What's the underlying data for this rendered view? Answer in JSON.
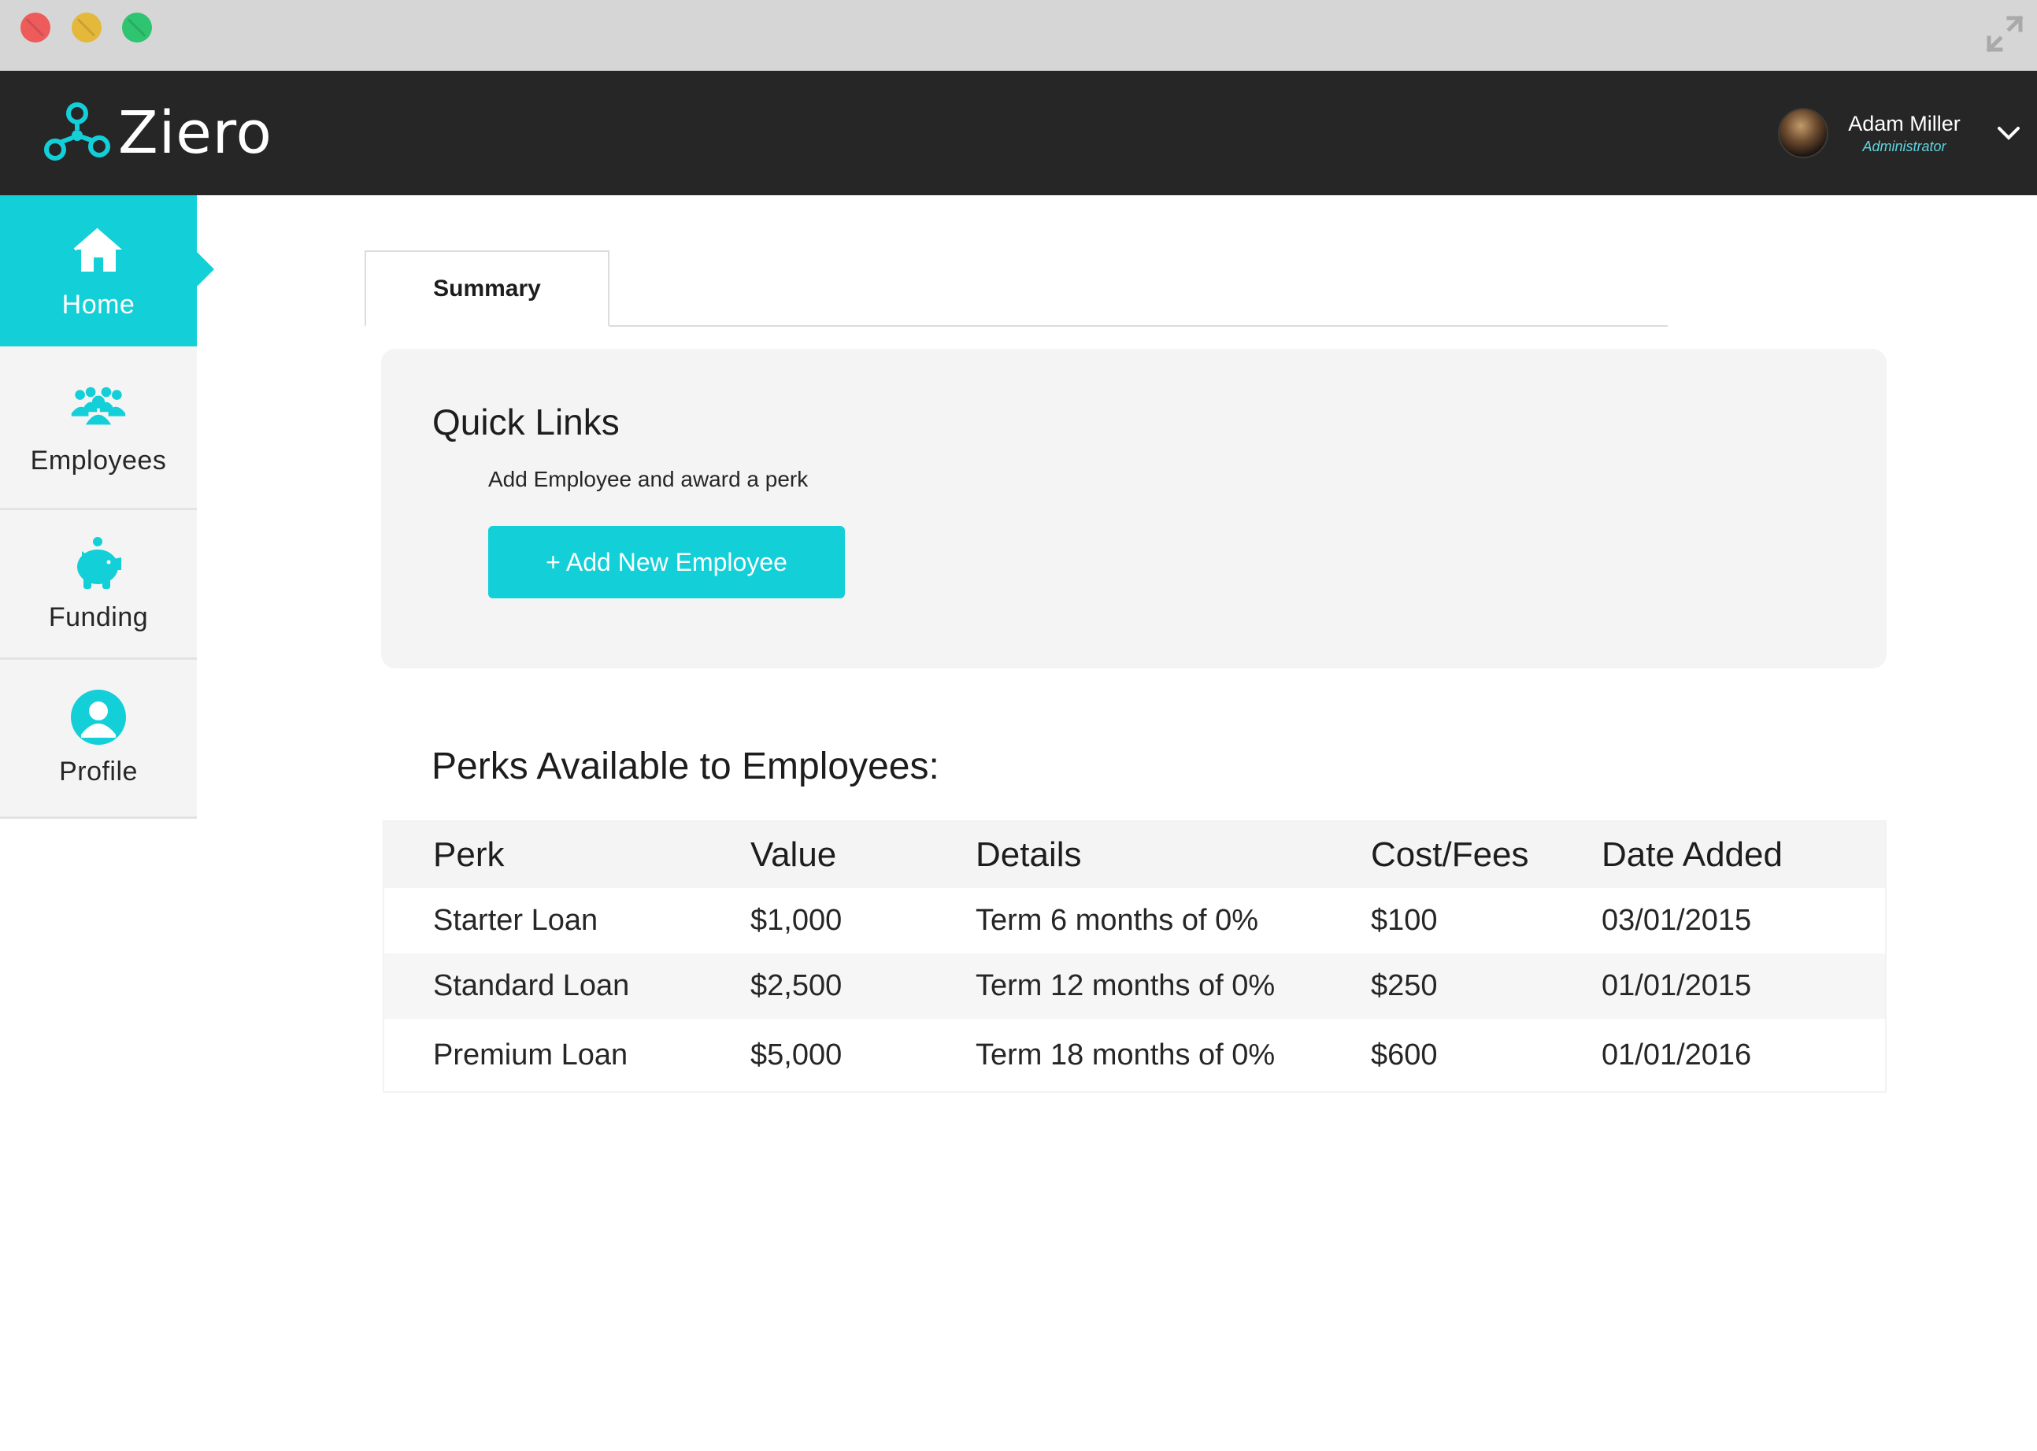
{
  "app": {
    "name": "Ziero",
    "brand_color": "#13cfd8",
    "header_color": "#262626"
  },
  "window": {
    "controls": [
      "close",
      "minimize",
      "zoom"
    ],
    "expand_icon": "expand-arrows-icon"
  },
  "user": {
    "name": "Adam Miller",
    "role": "Administrator",
    "menu_icon": "chevron-down-icon"
  },
  "sidebar": {
    "items": [
      {
        "label": "Home",
        "icon": "home-icon",
        "active": true
      },
      {
        "label": "Employees",
        "icon": "people-group-icon",
        "active": false
      },
      {
        "label": "Funding",
        "icon": "piggy-bank-icon",
        "active": false
      },
      {
        "label": "Profile",
        "icon": "user-circle-icon",
        "active": false
      }
    ]
  },
  "tabs": [
    {
      "label": "Summary",
      "active": true
    }
  ],
  "quick_links": {
    "title": "Quick Links",
    "subtitle": "Add Employee and award a perk",
    "button_label": "+ Add New Employee"
  },
  "perks": {
    "title": "Perks Available to Employees:",
    "columns": [
      "Perk",
      "Value",
      "Details",
      "Cost/Fees",
      "Date Added"
    ],
    "rows": [
      [
        "Starter Loan",
        "$1,000",
        "Term 6 months of 0%",
        "$100",
        "03/01/2015"
      ],
      [
        "Standard Loan",
        "$2,500",
        "Term 12 months of 0%",
        "$250",
        "01/01/2015"
      ],
      [
        "Premium Loan",
        "$5,000",
        "Term 18 months of 0%",
        "$600",
        "01/01/2016"
      ]
    ]
  }
}
